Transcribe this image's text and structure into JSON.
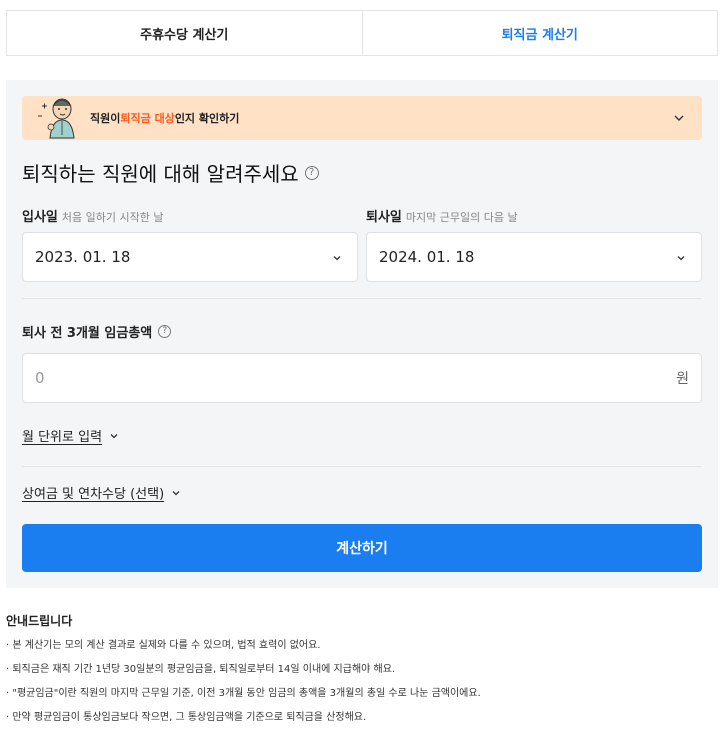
{
  "tabs": [
    {
      "label": "주휴수당 계산기",
      "active": false
    },
    {
      "label": "퇴직금 계산기",
      "active": true
    }
  ],
  "banner": {
    "text_before": "직원이 ",
    "highlight": "퇴직금 대상",
    "text_after": "인지 확인하기",
    "highlight_color": "#ff5a1f"
  },
  "form": {
    "heading": "퇴직하는 직원에 대해 알려주세요",
    "help_icon": "question-circle-icon",
    "start_date": {
      "label": "입사일",
      "sublabel": "처음 일하기 시작한 날",
      "value": "2023. 01. 18"
    },
    "end_date": {
      "label": "퇴사일",
      "sublabel": "마지막 근무일의 다음 날",
      "value": "2024. 01. 18"
    },
    "wage": {
      "label": "퇴사 전 3개월 임금총액",
      "placeholder": "0",
      "unit": "원"
    },
    "monthly_toggle": "월 단위로 입력",
    "bonus_toggle": "상여금 및 연차수당 (선택)",
    "submit": "계산하기"
  },
  "notice": {
    "title": "안내드립니다",
    "items": [
      "본 계산기는 모의 계산 결과로 실제와 다를 수 있으며, 법적 효력이 없어요.",
      "퇴직금은 재직 기간 1년당 30일분의 평균임금을, 퇴직일로부터 14일 이내에 지급해야 해요.",
      "\"평균임금\"이란 직원의 마지막 근무일 기준, 이전 3개월 동안 임금의 총액을 3개월의 총일 수로 나눈 금액이에요.",
      "만약 평균임금이 통상임금보다 작으면, 그 통상임금액을 기준으로 퇴직금을 산정해요."
    ]
  },
  "colors": {
    "accent": "#1a7df0",
    "banner_bg": "#ffe2c6",
    "panel_bg": "#f4f5f7"
  }
}
